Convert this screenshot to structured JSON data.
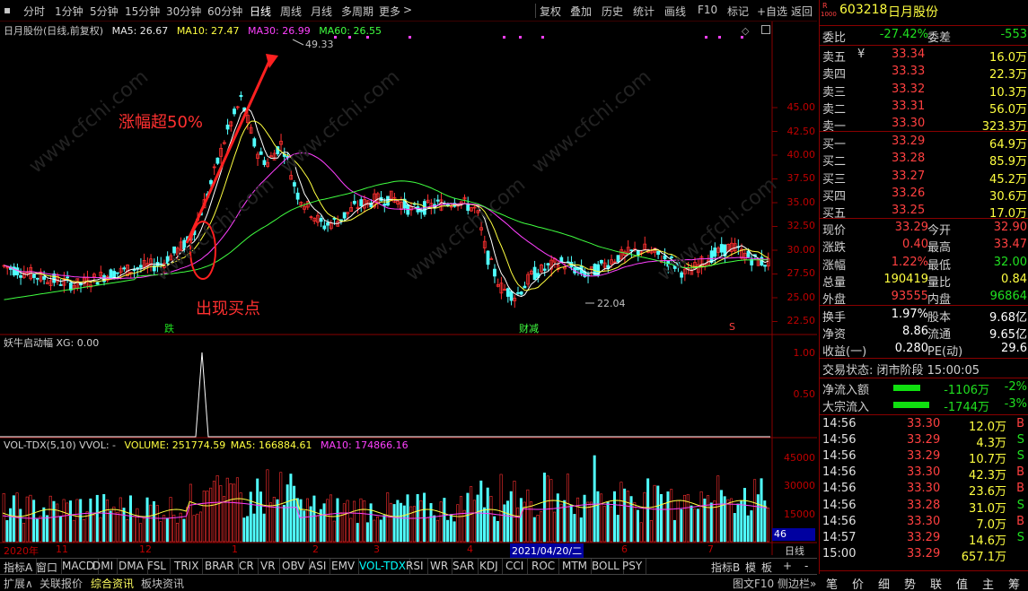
{
  "toolbar": {
    "periods": [
      "分时",
      "1分钟",
      "5分钟",
      "15分钟",
      "30分钟",
      "60分钟",
      "日线",
      "周线",
      "月线",
      "多周期",
      "更多"
    ],
    "tools": [
      "复权",
      "叠加",
      "历史",
      "统计",
      "画线",
      "F10",
      "标记",
      "+自选",
      "返回"
    ]
  },
  "main_chart": {
    "legend_name": "日月股份(日线,前复权)",
    "ma5": "MA5: 26.67",
    "ma10": "MA10: 27.47",
    "ma30": "MA30: 26.99",
    "ma60": "MA60: 26.55",
    "high_label": "49.33",
    "low_label": "22.04",
    "annotation_rise": "涨幅超50%",
    "annotation_buy": "出现买点",
    "marker_1": "跌",
    "marker_2": "财减",
    "marker_3": "S",
    "y_ticks": [
      "45.00",
      "42.50",
      "40.00",
      "37.50",
      "35.00",
      "32.50",
      "30.00",
      "27.50",
      "25.00",
      "22.50",
      "20.00"
    ]
  },
  "indicator": {
    "legend": "妖牛启动幅 XG: 0.00",
    "y_ticks": [
      "1.00",
      "0.50"
    ]
  },
  "volume": {
    "legend_name": "VOL-TDX(5,10) VVOL: -",
    "volume": "VOLUME: 251774.59",
    "ma5": "MA5: 166884.61",
    "ma10": "MA10: 174866.16",
    "y_ticks": [
      "45000",
      "30000",
      "15000"
    ],
    "corner": "46",
    "period_label": "日线"
  },
  "x_axis": {
    "labels": [
      "2020年",
      "11",
      "12",
      "1",
      "2",
      "3",
      "4",
      "2021/04/20/二",
      "6",
      "7"
    ]
  },
  "indicator_tabs": [
    "指标A",
    "窗口",
    "MACD",
    "DMI",
    "DMA",
    "FSL",
    "TRIX",
    "BRAR",
    "CR",
    "VR",
    "OBV",
    "ASI",
    "EMV",
    "VOL-TDX",
    "RSI",
    "WR",
    "SAR",
    "KDJ",
    "CCI",
    "ROC",
    "MTM",
    "BOLL",
    "PSY"
  ],
  "indicator_tabs_right": [
    "指标B",
    "模",
    "板",
    "+",
    "-"
  ],
  "bottom_bar": [
    "扩展∧",
    "关联报价",
    "综合资讯",
    "板块资讯"
  ],
  "bottom_right": "图文F10 侧边栏»",
  "quote": {
    "code": "603218",
    "name": "日月股份",
    "badge_r": "R",
    "badge_num": "1000",
    "weibi_label": "委比",
    "weibi": "-27.42%",
    "weicha_label": "委差",
    "weicha": "-553",
    "sells": [
      {
        "label": "卖五",
        "price": "33.34",
        "vol": "16.0万"
      },
      {
        "label": "卖四",
        "price": "33.33",
        "vol": "22.3万"
      },
      {
        "label": "卖三",
        "price": "33.32",
        "vol": "10.3万"
      },
      {
        "label": "卖二",
        "price": "33.31",
        "vol": "56.0万"
      },
      {
        "label": "卖一",
        "price": "33.30",
        "vol": "323.3万"
      }
    ],
    "sell_yen": "¥",
    "buys": [
      {
        "label": "买一",
        "price": "33.29",
        "vol": "64.9万"
      },
      {
        "label": "买二",
        "price": "33.28",
        "vol": "85.9万"
      },
      {
        "label": "买三",
        "price": "33.27",
        "vol": "45.2万"
      },
      {
        "label": "买四",
        "price": "33.26",
        "vol": "30.6万"
      },
      {
        "label": "买五",
        "price": "33.25",
        "vol": "17.0万"
      }
    ],
    "stats": [
      {
        "l1": "现价",
        "v1": "33.29",
        "l2": "今开",
        "v2": "32.90"
      },
      {
        "l1": "涨跌",
        "v1": "0.40",
        "l2": "最高",
        "v2": "33.47"
      },
      {
        "l1": "涨幅",
        "v1": "1.22%",
        "l2": "最低",
        "v2": "32.00"
      },
      {
        "l1": "总量",
        "v1": "190419",
        "l2": "量比",
        "v2": "0.84"
      },
      {
        "l1": "外盘",
        "v1": "93555",
        "l2": "内盘",
        "v2": "96864"
      }
    ],
    "stats2": [
      {
        "l1": "换手",
        "v1": "1.97%",
        "l2": "股本",
        "v2": "9.68亿"
      },
      {
        "l1": "净资",
        "v1": "8.86",
        "l2": "流通",
        "v2": "9.65亿"
      },
      {
        "l1": "收益(一)",
        "v1": "0.280",
        "l2": "PE(动)",
        "v2": "29.6"
      }
    ],
    "trade_status": "交易状态: 闭市阶段 15:00:05",
    "flow": [
      {
        "label": "净流入额",
        "value": "-1106万",
        "pct": "-2%"
      },
      {
        "label": "大宗流入",
        "value": "-1744万",
        "pct": "-3%"
      }
    ],
    "ticks": [
      {
        "t": "14:56",
        "p": "33.30",
        "v": "12.0万",
        "s": "B"
      },
      {
        "t": "14:56",
        "p": "33.29",
        "v": "4.3万",
        "s": "S"
      },
      {
        "t": "14:56",
        "p": "33.29",
        "v": "10.7万",
        "s": "S"
      },
      {
        "t": "14:56",
        "p": "33.30",
        "v": "42.3万",
        "s": "B"
      },
      {
        "t": "14:56",
        "p": "33.30",
        "v": "23.6万",
        "s": "B"
      },
      {
        "t": "14:56",
        "p": "33.28",
        "v": "31.0万",
        "s": "S"
      },
      {
        "t": "14:56",
        "p": "33.30",
        "v": "7.0万",
        "s": "B"
      },
      {
        "t": "14:57",
        "p": "33.29",
        "v": "14.6万",
        "s": "S"
      },
      {
        "t": "15:00",
        "p": "33.29",
        "v": "657.1万",
        "s": ""
      }
    ],
    "side_tabs": [
      "笔",
      "价",
      "细",
      "势",
      "联",
      "值",
      "主",
      "筹"
    ]
  }
}
